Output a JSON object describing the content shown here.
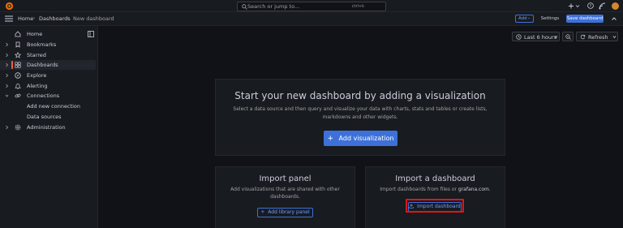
{
  "search": {
    "placeholder": "Search or jump to...",
    "shortcut": "ctrl+k"
  },
  "breadcrumb": {
    "home": "Home",
    "dashboards": "Dashboards",
    "current": "New dashboard"
  },
  "toolbar": {
    "add_label": "Add",
    "settings_label": "Settings",
    "save_label": "Save dashboard"
  },
  "sidebar": {
    "items": [
      {
        "label": "Home",
        "icon": "home-icon"
      },
      {
        "label": "Bookmarks",
        "icon": "bookmark-icon"
      },
      {
        "label": "Starred",
        "icon": "star-icon"
      },
      {
        "label": "Dashboards",
        "icon": "apps-icon"
      },
      {
        "label": "Explore",
        "icon": "compass-icon"
      },
      {
        "label": "Alerting",
        "icon": "bell-icon"
      },
      {
        "label": "Connections",
        "icon": "link-icon"
      },
      {
        "label": "Administration",
        "icon": "cog-icon"
      }
    ],
    "sub_items": [
      "Add new connection",
      "Data sources"
    ]
  },
  "controls": {
    "time_range": "Last 6 hours",
    "refresh": "Refresh"
  },
  "main_card": {
    "title": "Start your new dashboard by adding a visualization",
    "desc_line1": "Select a data source and then query and visualize your data with charts, stats and tables or create lists,",
    "desc_line2": "markdowns and other widgets.",
    "button": "Add visualization"
  },
  "library_card": {
    "title": "Import panel",
    "desc_line1": "Add visualizations that are shared with other",
    "desc_line2": "dashboards.",
    "button": "Add library panel"
  },
  "import_card": {
    "title": "Import a dashboard",
    "desc_prefix": "Import dashboards from files or ",
    "desc_link": "grafana.com",
    "desc_suffix": ".",
    "button": "Import dashboard"
  },
  "colors": {
    "accent": "#3d71d9",
    "active_bar": "#f55f3e",
    "highlight": "#e0141b",
    "background": "#111217",
    "panel": "#181b1f"
  }
}
